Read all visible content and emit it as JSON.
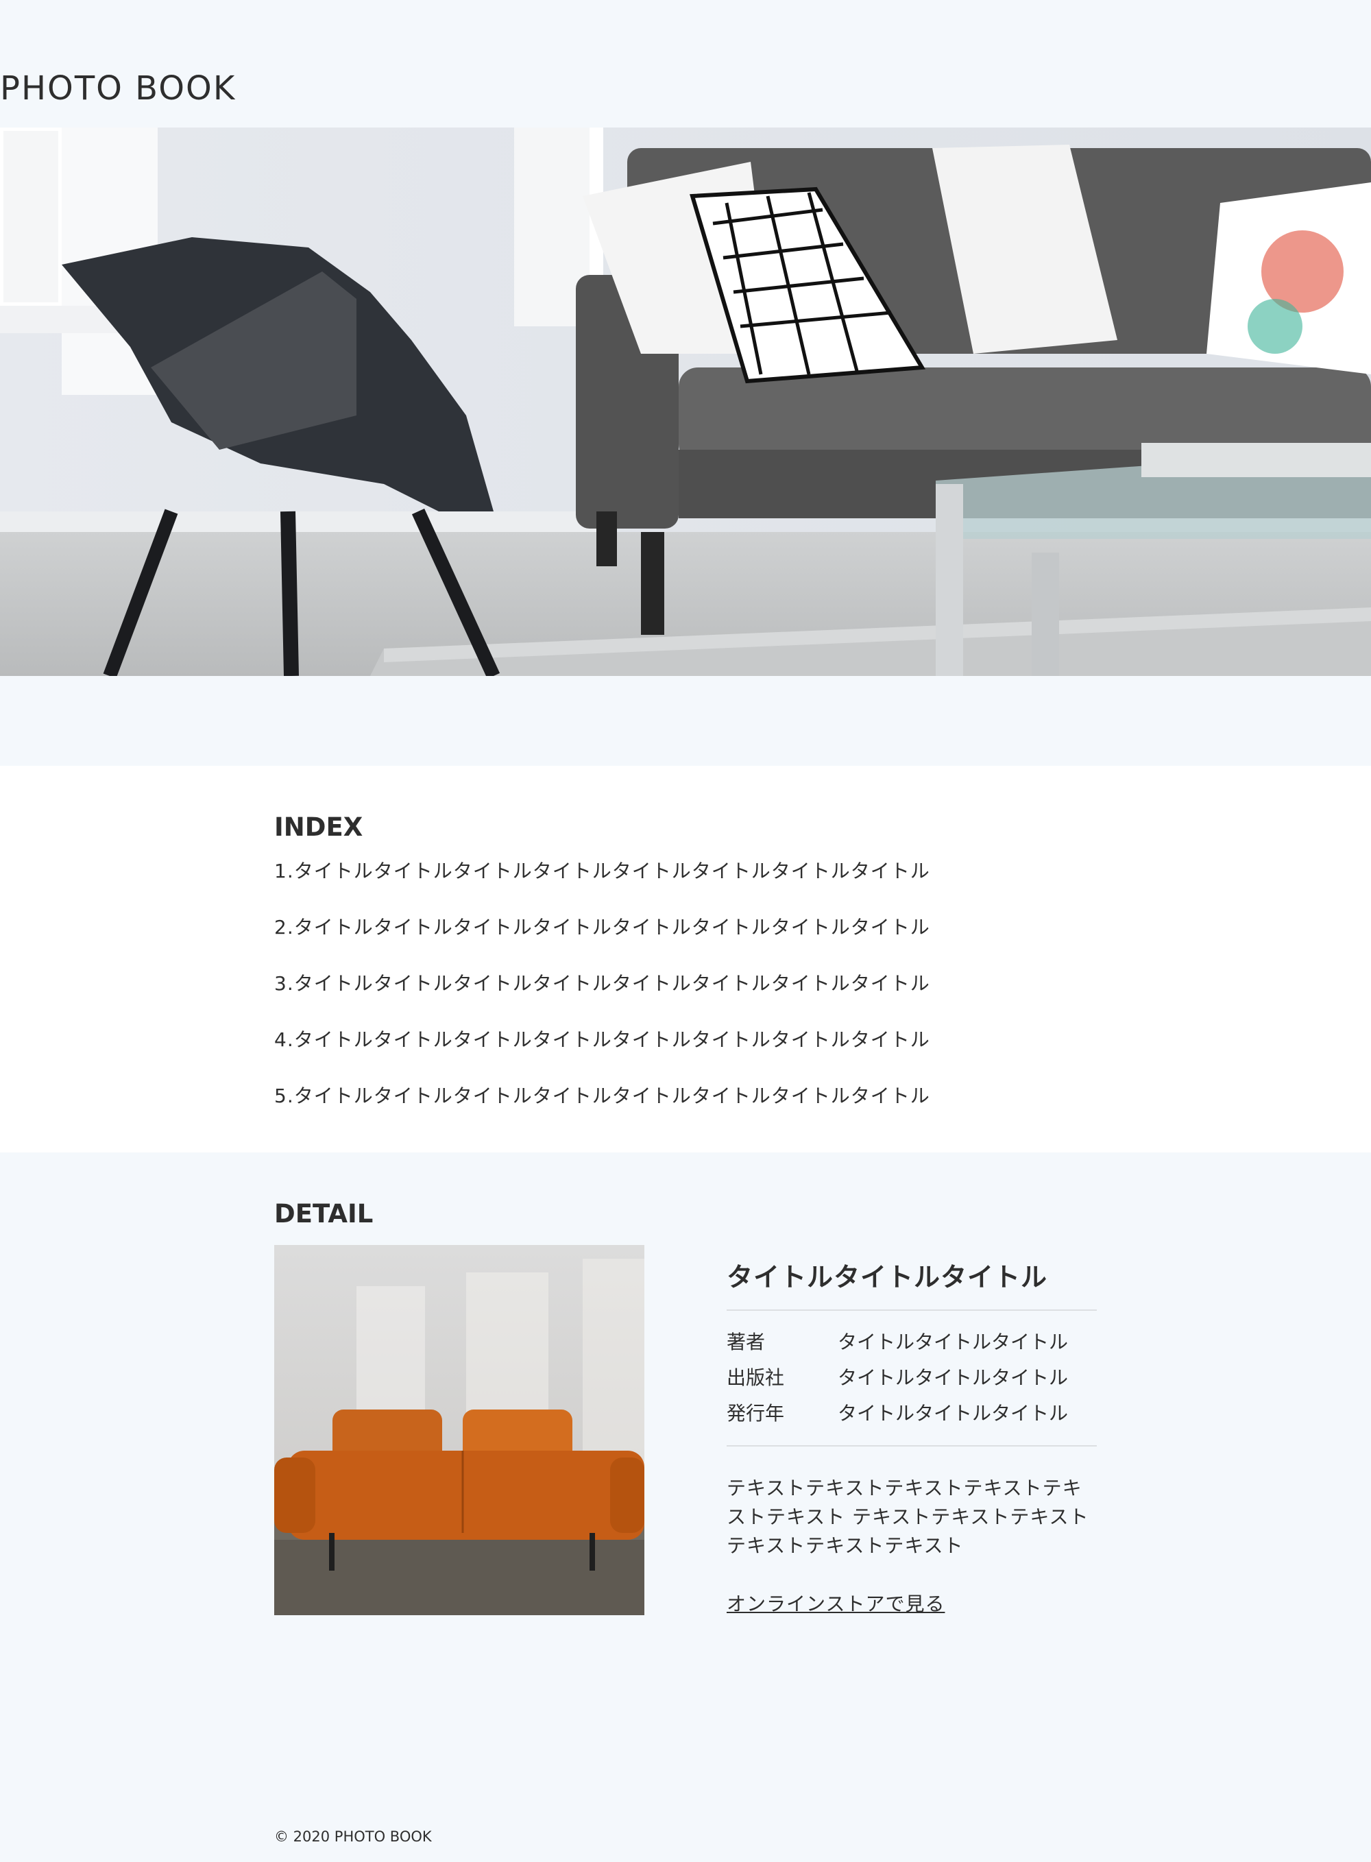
{
  "header": {
    "site_title": "PHOTO BOOK"
  },
  "hero": {
    "image": "living-room-photo"
  },
  "index": {
    "heading": "INDEX",
    "items": [
      "1.タイトルタイトルタイトルタイトルタイトルタイトルタイトルタイトル",
      "2.タイトルタイトルタイトルタイトルタイトルタイトルタイトルタイトル",
      "3.タイトルタイトルタイトルタイトルタイトルタイトルタイトルタイトル",
      "4.タイトルタイトルタイトルタイトルタイトルタイトルタイトルタイトル",
      "5.タイトルタイトルタイトルタイトルタイトルタイトルタイトルタイトル"
    ]
  },
  "detail": {
    "heading": "DETAIL",
    "image": "orange-sofa-photo",
    "title": "タイトルタイトルタイトル",
    "meta": [
      {
        "key": "著者",
        "value": "タイトルタイトルタイトル"
      },
      {
        "key": "出版社",
        "value": "タイトルタイトルタイトル"
      },
      {
        "key": "発行年",
        "value": "タイトルタイトルタイトル"
      }
    ],
    "description": "テキストテキストテキストテキストテキストテキスト テキストテキストテキストテキストテキストテキスト",
    "link_label": "オンラインストアで見る"
  },
  "footer": {
    "copyright": "© 2020 PHOTO BOOK"
  },
  "colors": {
    "page_bg": "#f4f8fc",
    "section_bg": "#ffffff",
    "text": "#2e2e2e",
    "divider": "#dcdfe2"
  }
}
